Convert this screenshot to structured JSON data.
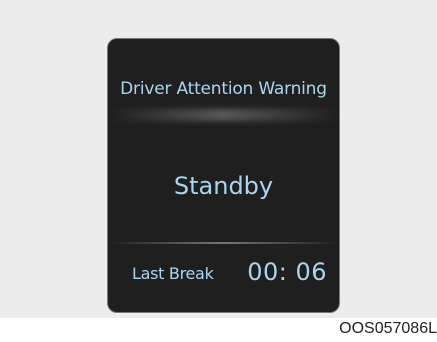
{
  "panel": {
    "title": "Driver Attention Warning",
    "status": "Standby",
    "last_break_label": "Last Break",
    "last_break_time": "00: 06"
  },
  "figure_code": "OOS057086L",
  "colors": {
    "display_text": "#a9d6ee",
    "screen_background": "#1f1f1f",
    "frame_background": "#ececec"
  }
}
